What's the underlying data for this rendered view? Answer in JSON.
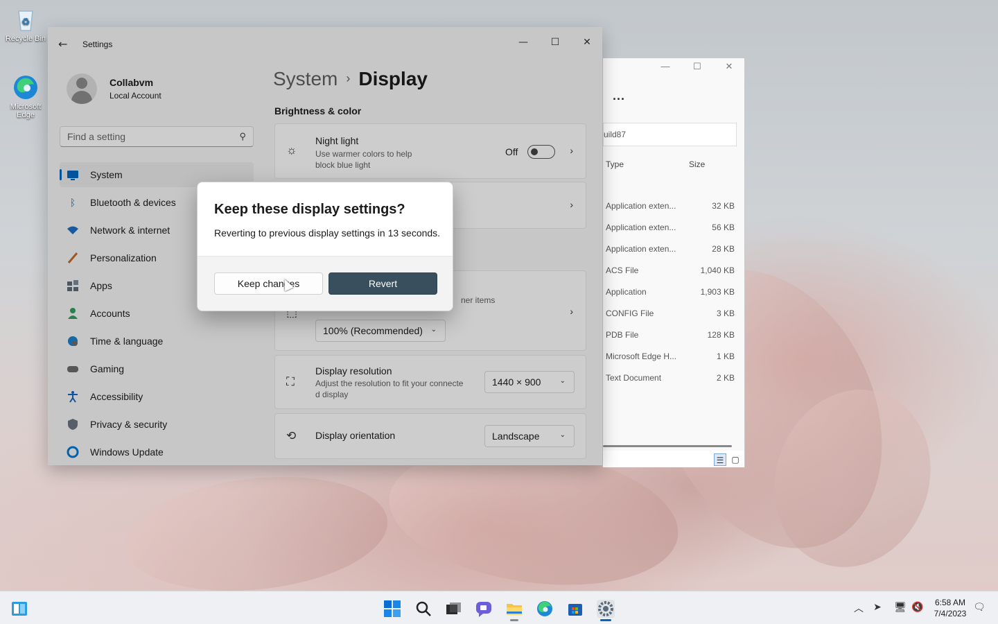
{
  "desktop": {
    "icons": [
      {
        "label": "Recycle Bin",
        "icon": "recycle-bin-icon"
      },
      {
        "label": "Microsoft Edge",
        "icon": "edge-icon"
      }
    ]
  },
  "settings": {
    "window_title": "Settings",
    "profile": {
      "name": "Collabvm",
      "account": "Local Account"
    },
    "search_placeholder": "Find a setting",
    "nav": [
      {
        "label": "System",
        "icon": "system-icon",
        "color": "#0067c0"
      },
      {
        "label": "Bluetooth & devices",
        "icon": "bluetooth-icon",
        "color": "#0078d4"
      },
      {
        "label": "Network & internet",
        "icon": "wifi-icon",
        "color": "#1a6fc2"
      },
      {
        "label": "Personalization",
        "icon": "paintbrush-icon",
        "color": "#c06a2b"
      },
      {
        "label": "Apps",
        "icon": "apps-icon",
        "color": "#5b6b7a"
      },
      {
        "label": "Accounts",
        "icon": "accounts-icon",
        "color": "#2e9e5e"
      },
      {
        "label": "Time & language",
        "icon": "globe-clock-icon",
        "color": "#1b7fcc"
      },
      {
        "label": "Gaming",
        "icon": "gamepad-icon",
        "color": "#6b6b6b"
      },
      {
        "label": "Accessibility",
        "icon": "accessibility-icon",
        "color": "#1565c0"
      },
      {
        "label": "Privacy & security",
        "icon": "shield-icon",
        "color": "#6b7380"
      },
      {
        "label": "Windows Update",
        "icon": "update-icon",
        "color": "#0078d4"
      }
    ],
    "breadcrumb": {
      "parent": "System",
      "current": "Display"
    },
    "section_title": "Brightness & color",
    "night_light": {
      "title": "Night light",
      "subtitle_1": "Use warmer colors to help",
      "subtitle_2": "block blue light",
      "state": "Off"
    },
    "scale_text_partial": "ner items",
    "scale_value": "100% (Recommended)",
    "resolution": {
      "title": "Display resolution",
      "subtitle_1": "Adjust the resolution to fit your connecte",
      "subtitle_2": "d display",
      "value": "1440 × 900"
    },
    "orientation": {
      "title": "Display orientation",
      "value": "Landscape"
    }
  },
  "dialog": {
    "title": "Keep these display settings?",
    "message": "Reverting to previous display settings in 13 seconds.",
    "keep_label": "Keep changes",
    "revert_label": "Revert"
  },
  "explorer": {
    "more_label": "...",
    "address_partial": "uild87",
    "columns": [
      "Type",
      "Size"
    ],
    "rows": [
      {
        "type": "Application exten...",
        "size": "32 KB"
      },
      {
        "type": "Application exten...",
        "size": "56 KB"
      },
      {
        "type": "Application exten...",
        "size": "28 KB"
      },
      {
        "type": "ACS File",
        "size": "1,040 KB"
      },
      {
        "type": "Application",
        "size": "1,903 KB"
      },
      {
        "type": "CONFIG File",
        "size": "3 KB"
      },
      {
        "type": "PDB File",
        "size": "128 KB"
      },
      {
        "type": "Microsoft Edge H...",
        "size": "1 KB"
      },
      {
        "type": "Text Document",
        "size": "2 KB"
      }
    ]
  },
  "taskbar": {
    "time": "6:58 AM",
    "date": "7/4/2023"
  }
}
